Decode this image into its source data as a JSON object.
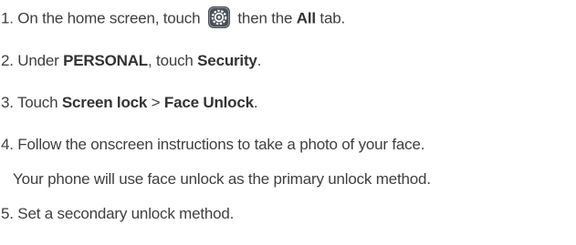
{
  "steps": [
    {
      "number": "1.",
      "text_a": " On the home screen, touch ",
      "icon": "settings-gear-icon",
      "text_b": " then the ",
      "bold_a": "All",
      "text_c": " tab."
    },
    {
      "number": "2.",
      "text_a": " Under ",
      "bold_a": "PERSONAL",
      "text_b": ", touch ",
      "bold_b": "Security",
      "text_c": "."
    },
    {
      "number": "3.",
      "text_a": " Touch ",
      "bold_a": "Screen lock",
      "text_b": " > ",
      "bold_b": "Face Unlock",
      "text_c": "."
    },
    {
      "number": "4.",
      "text_a": " Follow the onscreen instructions to take a photo of your face."
    },
    {
      "note": "Your phone will use face unlock as the primary unlock method."
    },
    {
      "number": "5.",
      "text_a": " Set a secondary unlock method."
    }
  ],
  "colors": {
    "text": "#3f3f3f",
    "icon_bg": "#4a4f57",
    "icon_fg": "#ffffff"
  }
}
